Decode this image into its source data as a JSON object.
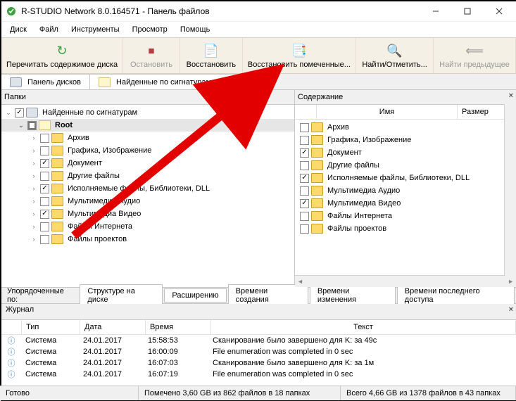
{
  "window": {
    "title": "R-STUDIO Network 8.0.164571 - Панель файлов"
  },
  "menus": [
    "Диск",
    "Файл",
    "Инструменты",
    "Просмотр",
    "Помощь"
  ],
  "toolbar": [
    {
      "id": "reread",
      "label": "Перечитать содержимое диска",
      "disabled": false
    },
    {
      "id": "stop",
      "label": "Остановить",
      "disabled": true
    },
    {
      "id": "recover",
      "label": "Восстановить",
      "disabled": false
    },
    {
      "id": "recover-marked",
      "label": "Восстановить помеченные...",
      "disabled": false
    },
    {
      "id": "find",
      "label": "Найти/Отметить...",
      "disabled": false
    },
    {
      "id": "find-prev",
      "label": "Найти предыдущее",
      "disabled": true
    }
  ],
  "tabs": [
    {
      "label": "Панель дисков",
      "icon": "disk"
    },
    {
      "label": "Найденные по сигнатурам -> K:",
      "icon": "folder"
    }
  ],
  "leftPane": {
    "title": "Папки",
    "nodes": [
      {
        "depth": 0,
        "expand": "open",
        "cb": "chk",
        "icon": "disk",
        "label": "Найденные по сигнатурам",
        "bold": false
      },
      {
        "depth": 1,
        "expand": "open",
        "cb": "sq",
        "icon": "ext",
        "label": "Root",
        "bold": true,
        "sel": true
      },
      {
        "depth": 2,
        "expand": "closed",
        "cb": "none",
        "icon": "folder",
        "label": "Архив"
      },
      {
        "depth": 2,
        "expand": "closed",
        "cb": "none",
        "icon": "folder",
        "label": "Графика, Изображение"
      },
      {
        "depth": 2,
        "expand": "closed",
        "cb": "chk",
        "icon": "folder",
        "label": "Документ"
      },
      {
        "depth": 2,
        "expand": "closed",
        "cb": "none",
        "icon": "folder",
        "label": "Другие файлы"
      },
      {
        "depth": 2,
        "expand": "closed",
        "cb": "chk",
        "icon": "folder",
        "label": "Исполняемые файлы, Библиотеки, DLL"
      },
      {
        "depth": 2,
        "expand": "closed",
        "cb": "none",
        "icon": "folder",
        "label": "Мультимедиа Аудио"
      },
      {
        "depth": 2,
        "expand": "closed",
        "cb": "chk",
        "icon": "folder",
        "label": "Мультимедиа Видео"
      },
      {
        "depth": 2,
        "expand": "closed",
        "cb": "none",
        "icon": "folder",
        "label": "Файлы Интернета"
      },
      {
        "depth": 2,
        "expand": "closed",
        "cb": "none",
        "icon": "folder",
        "label": "Файлы проектов"
      }
    ]
  },
  "rightPane": {
    "title": "Содержание",
    "columns": [
      "Имя",
      "Размер"
    ],
    "rows": [
      {
        "cb": "none",
        "label": "Архив"
      },
      {
        "cb": "none",
        "label": "Графика, Изображение"
      },
      {
        "cb": "chk",
        "label": "Документ"
      },
      {
        "cb": "none",
        "label": "Другие файлы"
      },
      {
        "cb": "chk",
        "label": "Исполняемые файлы, Библиотеки, DLL"
      },
      {
        "cb": "none",
        "label": "Мультимедиа Аудио"
      },
      {
        "cb": "chk",
        "label": "Мультимедиа Видео"
      },
      {
        "cb": "none",
        "label": "Файлы Интернета"
      },
      {
        "cb": "none",
        "label": "Файлы проектов"
      }
    ]
  },
  "sort": {
    "label": "Упорядоченные по:",
    "buttons": [
      "Структуре на диске",
      "Расширению",
      "Времени создания",
      "Времени изменения",
      "Времени последнего доступа"
    ]
  },
  "log": {
    "title": "Журнал",
    "columns": [
      "Тип",
      "Дата",
      "Время",
      "Текст"
    ],
    "rows": [
      {
        "type": "Система",
        "date": "24.01.2017",
        "time": "15:58:53",
        "text": "Сканирование было завершено для K: за 49с"
      },
      {
        "type": "Система",
        "date": "24.01.2017",
        "time": "16:00:09",
        "text": "File enumeration was completed in 0 sec"
      },
      {
        "type": "Система",
        "date": "24.01.2017",
        "time": "16:07:03",
        "text": "Сканирование было завершено для K: за 1м"
      },
      {
        "type": "Система",
        "date": "24.01.2017",
        "time": "16:07:19",
        "text": "File enumeration was completed in 0 sec"
      }
    ]
  },
  "status": {
    "ready": "Готово",
    "marked": "Помечено 3,60 GB из 862 файлов в 18 папках",
    "total": "Всего 4,66 GB из 1378 файлов в 43 папках"
  }
}
